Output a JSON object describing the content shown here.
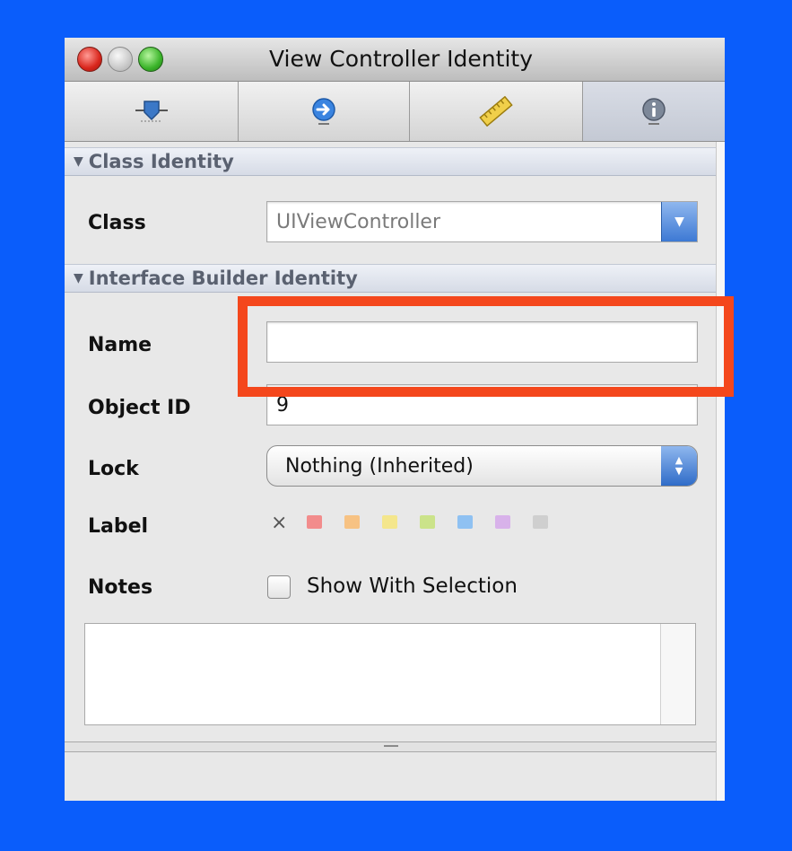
{
  "window": {
    "title": "View Controller Identity"
  },
  "toolbar": {
    "tabs": [
      {
        "icon": "attributes-icon"
      },
      {
        "icon": "connections-icon"
      },
      {
        "icon": "size-ruler-icon"
      },
      {
        "icon": "identity-info-icon",
        "active": true
      }
    ]
  },
  "class_identity": {
    "header": "Class Identity",
    "class_label": "Class",
    "class_value": "UIViewController"
  },
  "ib_identity": {
    "header": "Interface Builder Identity",
    "name_label": "Name",
    "name_value": "",
    "object_id_label": "Object ID",
    "object_id_value": "9",
    "lock_label": "Lock",
    "lock_value": "Nothing (Inherited)",
    "label_label": "Label",
    "label_clear": "×",
    "label_colors": [
      "#f28c8c",
      "#f7c283",
      "#f4e68c",
      "#cbe38a",
      "#8fc1f2",
      "#d8b2ea",
      "#cfcfcf"
    ],
    "notes_label": "Notes",
    "show_with_selection": "Show With Selection",
    "notes_text": ""
  },
  "annotation": {
    "color": "#f4471c"
  }
}
